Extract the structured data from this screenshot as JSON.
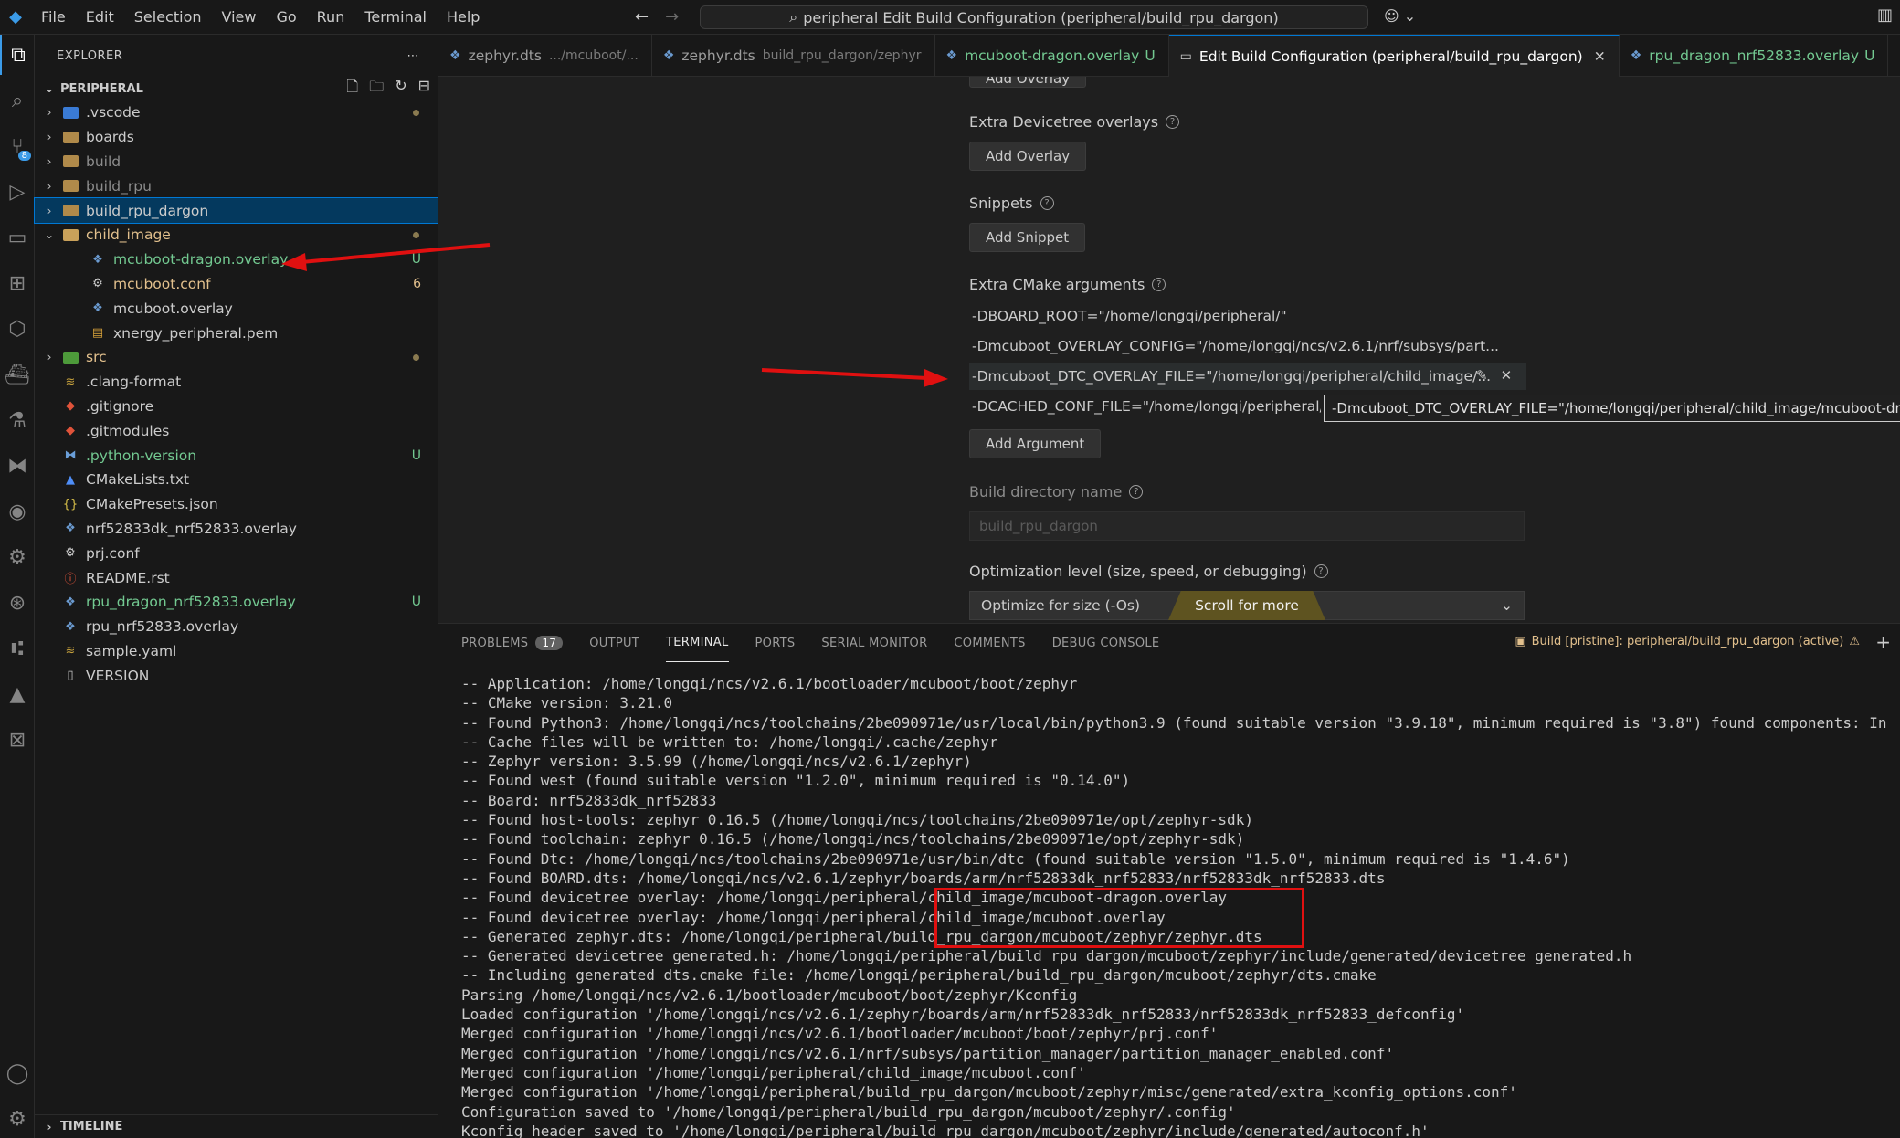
{
  "menu": [
    "File",
    "Edit",
    "Selection",
    "View",
    "Go",
    "Run",
    "Terminal",
    "Help"
  ],
  "command_center": "peripheral Edit Build Configuration (peripheral/build_rpu_dargon)",
  "sidebar": {
    "title": "EXPLORER",
    "section": "PERIPHERAL",
    "timeline": "TIMELINE",
    "tree": [
      {
        "label": ".vscode",
        "type": "folder",
        "color": "blue",
        "indent": 1,
        "open": false,
        "status": "dot"
      },
      {
        "label": "boards",
        "type": "folder",
        "indent": 1,
        "open": false
      },
      {
        "label": "build",
        "type": "folder",
        "indent": 1,
        "open": false,
        "dim": true
      },
      {
        "label": "build_rpu",
        "type": "folder",
        "indent": 1,
        "open": false,
        "dim": true
      },
      {
        "label": "build_rpu_dargon",
        "type": "folder",
        "indent": 1,
        "open": false,
        "selected": true
      },
      {
        "label": "child_image",
        "type": "folder",
        "indent": 1,
        "open": true,
        "labelClass": "c-yellow",
        "status": "dot"
      },
      {
        "label": "mcuboot-dragon.overlay",
        "type": "overlay",
        "indent": 2,
        "labelClass": "c-green",
        "status": "U"
      },
      {
        "label": "mcuboot.conf",
        "type": "gear",
        "indent": 2,
        "labelClass": "c-yellow",
        "status": "6"
      },
      {
        "label": "mcuboot.overlay",
        "type": "overlay",
        "indent": 2
      },
      {
        "label": "xnergy_peripheral.pem",
        "type": "pem",
        "indent": 2
      },
      {
        "label": "src",
        "type": "folder",
        "color": "green",
        "indent": 1,
        "open": false,
        "labelClass": "c-yellow",
        "status": "dot"
      },
      {
        "label": ".clang-format",
        "type": "yaml",
        "indent": 1
      },
      {
        "label": ".gitignore",
        "type": "git",
        "indent": 1
      },
      {
        "label": ".gitmodules",
        "type": "git",
        "indent": 1
      },
      {
        "label": ".python-version",
        "type": "python",
        "indent": 1,
        "labelClass": "c-green",
        "status": "U"
      },
      {
        "label": "CMakeLists.txt",
        "type": "cmake",
        "indent": 1
      },
      {
        "label": "CMakePresets.json",
        "type": "json",
        "indent": 1
      },
      {
        "label": "nrf52833dk_nrf52833.overlay",
        "type": "overlay",
        "indent": 1
      },
      {
        "label": "prj.conf",
        "type": "gear",
        "indent": 1
      },
      {
        "label": "README.rst",
        "type": "readme",
        "indent": 1
      },
      {
        "label": "rpu_dragon_nrf52833.overlay",
        "type": "overlay",
        "indent": 1,
        "labelClass": "c-green",
        "status": "U"
      },
      {
        "label": "rpu_nrf52833.overlay",
        "type": "overlay",
        "indent": 1
      },
      {
        "label": "sample.yaml",
        "type": "yaml",
        "indent": 1
      },
      {
        "label": "VERSION",
        "type": "file",
        "indent": 1
      }
    ]
  },
  "tabs": [
    {
      "label": "zephyr.dts",
      "desc": ".../mcuboot/...",
      "active": false
    },
    {
      "label": "zephyr.dts",
      "desc": "build_rpu_dargon/zephyr",
      "active": false
    },
    {
      "label": "mcuboot-dragon.overlay",
      "suffix": "U",
      "active": false,
      "green": true
    },
    {
      "label": "Edit Build Configuration (peripheral/build_rpu_dargon)",
      "active": true,
      "closable": true
    },
    {
      "label": "rpu_dragon_nrf52833.overlay",
      "suffix": "U",
      "active": false,
      "green": true
    }
  ],
  "form": {
    "cut_button": "Add Overlay",
    "extra_dt_label": "Extra Devicetree overlays",
    "add_overlay": "Add Overlay",
    "snippets_label": "Snippets",
    "add_snippet": "Add Snippet",
    "cmake_label": "Extra CMake arguments",
    "args": [
      "-DBOARD_ROOT=\"/home/longqi/peripheral/\"",
      "-Dmcuboot_OVERLAY_CONFIG=\"/home/longqi/ncs/v2.6.1/nrf/subsys/part...",
      "-Dmcuboot_DTC_OVERLAY_FILE=\"/home/longqi/peripheral/child_image/...",
      "-DCACHED_CONF_FILE=\"/home/longqi/peripheral/prj."
    ],
    "tooltip": "-Dmcuboot_DTC_OVERLAY_FILE=\"/home/longqi/peripheral/child_image/mcuboot-dragon.overlay;/home/longqi/peripheral/child_image/mcuboot.overlay\"",
    "add_argument": "Add Argument",
    "build_dir_label": "Build directory name",
    "build_dir_value": "build_rpu_dargon",
    "opt_label": "Optimization level (size, speed, or debugging)",
    "opt_value": "Optimize for size (-Os)",
    "scroll_more": "Scroll for more"
  },
  "panel": {
    "tabs": [
      {
        "label": "PROBLEMS",
        "count": "17"
      },
      {
        "label": "OUTPUT"
      },
      {
        "label": "TERMINAL",
        "active": true
      },
      {
        "label": "PORTS"
      },
      {
        "label": "SERIAL MONITOR"
      },
      {
        "label": "COMMENTS"
      },
      {
        "label": "DEBUG CONSOLE"
      }
    ],
    "build_status": "Build [pristine]: peripheral/build_rpu_dargon (active)",
    "terminal_lines": [
      "-- Application: /home/longqi/ncs/v2.6.1/bootloader/mcuboot/boot/zephyr",
      "-- CMake version: 3.21.0",
      "-- Found Python3: /home/longqi/ncs/toolchains/2be090971e/usr/local/bin/python3.9 (found suitable version \"3.9.18\", minimum required is \"3.8\") found components: In",
      "-- Cache files will be written to: /home/longqi/.cache/zephyr",
      "-- Zephyr version: 3.5.99 (/home/longqi/ncs/v2.6.1/zephyr)",
      "-- Found west (found suitable version \"1.2.0\", minimum required is \"0.14.0\")",
      "-- Board: nrf52833dk_nrf52833",
      "-- Found host-tools: zephyr 0.16.5 (/home/longqi/ncs/toolchains/2be090971e/opt/zephyr-sdk)",
      "-- Found toolchain: zephyr 0.16.5 (/home/longqi/ncs/toolchains/2be090971e/opt/zephyr-sdk)",
      "-- Found Dtc: /home/longqi/ncs/toolchains/2be090971e/usr/bin/dtc (found suitable version \"1.5.0\", minimum required is \"1.4.6\")",
      "-- Found BOARD.dts: /home/longqi/ncs/v2.6.1/zephyr/boards/arm/nrf52833dk_nrf52833/nrf52833dk_nrf52833.dts",
      "-- Found devicetree overlay: /home/longqi/peripheral/child_image/mcuboot-dragon.overlay",
      "-- Found devicetree overlay: /home/longqi/peripheral/child_image/mcuboot.overlay",
      "-- Generated zephyr.dts: /home/longqi/peripheral/build_rpu_dargon/mcuboot/zephyr/zephyr.dts",
      "-- Generated devicetree_generated.h: /home/longqi/peripheral/build_rpu_dargon/mcuboot/zephyr/include/generated/devicetree_generated.h",
      "-- Including generated dts.cmake file: /home/longqi/peripheral/build_rpu_dargon/mcuboot/zephyr/dts.cmake",
      "Parsing /home/longqi/ncs/v2.6.1/bootloader/mcuboot/boot/zephyr/Kconfig",
      "Loaded configuration '/home/longqi/ncs/v2.6.1/zephyr/boards/arm/nrf52833dk_nrf52833/nrf52833dk_nrf52833_defconfig'",
      "Merged configuration '/home/longqi/ncs/v2.6.1/bootloader/mcuboot/boot/zephyr/prj.conf'",
      "Merged configuration '/home/longqi/ncs/v2.6.1/nrf/subsys/partition_manager/partition_manager_enabled.conf'",
      "Merged configuration '/home/longqi/peripheral/child_image/mcuboot.conf'",
      "Merged configuration '/home/longqi/peripheral/build_rpu_dargon/mcuboot/zephyr/misc/generated/extra_kconfig_options.conf'",
      "Configuration saved to '/home/longqi/peripheral/build_rpu_dargon/mcuboot/zephyr/.config'",
      "Kconfig header saved to '/home/longqi/peripheral/build_rpu_dargon/mcuboot/zephyr/include/generated/autoconf.h'"
    ]
  },
  "colors": {
    "accent": "#0078d4",
    "annotation": "#e01010",
    "untracked": "#73c991",
    "modified": "#e2c08d"
  }
}
